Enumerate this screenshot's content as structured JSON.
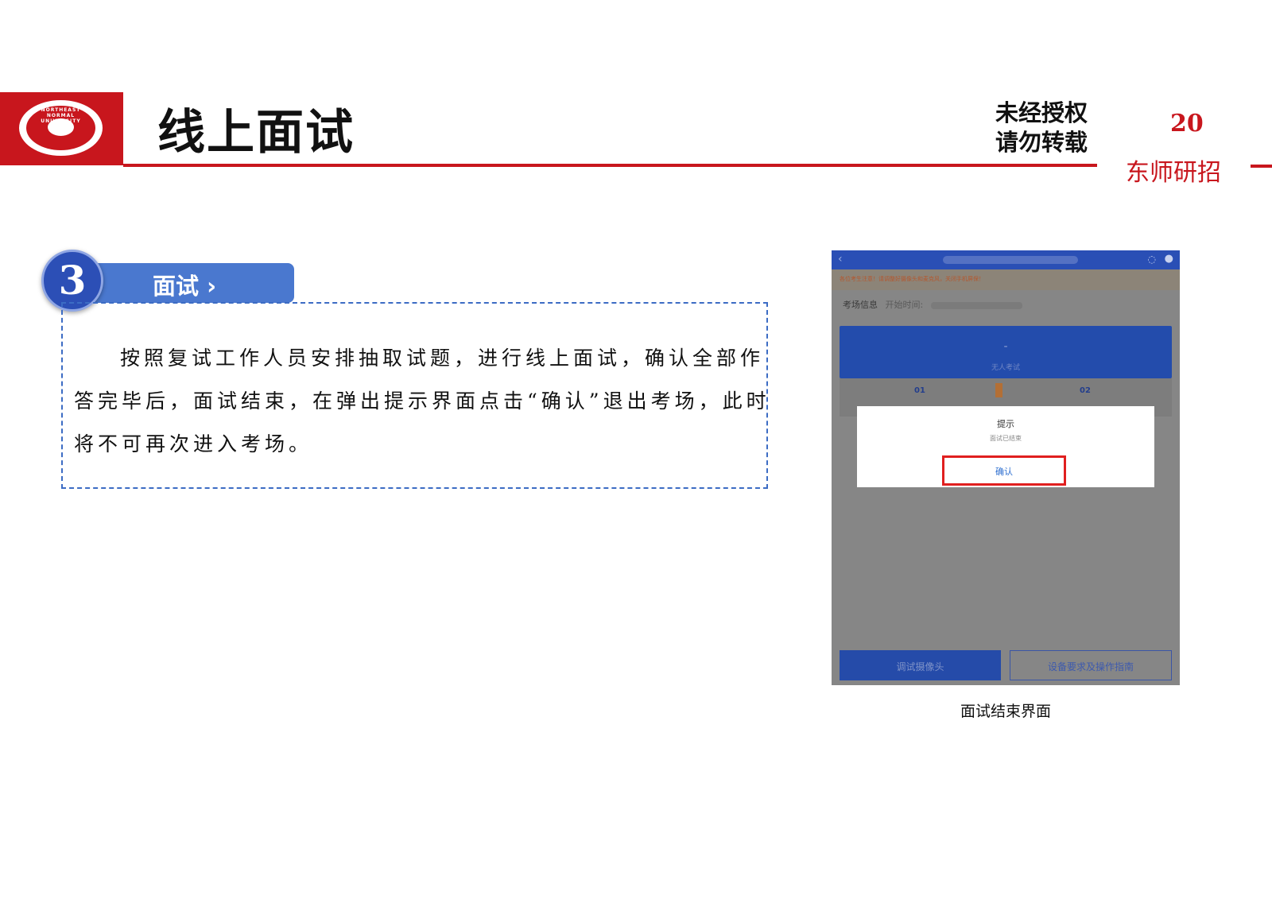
{
  "header": {
    "title": "线上面试",
    "watermark_line1": "未经授权",
    "watermark_line2": "请勿转载",
    "page_number": "20",
    "brand": "东师研招"
  },
  "step": {
    "number": "3",
    "label": "面试 ›"
  },
  "body": {
    "paragraph": "按照复试工作人员安排抽取试题，进行线上面试，确认全部作答完毕后，面试结束，在弹出提示界面点击“确认”退出考场，此时将不可再次进入考场。"
  },
  "screenshot": {
    "notice": "各位考生注意！请调整好摄像头和麦克风，关闭手机屏保！",
    "info_label": "考场信息",
    "info_time_label": "开始时间:",
    "card_dash": "-",
    "card_subtitle": "无人考试",
    "step_01": "01",
    "step_02": "02",
    "dialog": {
      "title": "提示",
      "message": "面试已结束",
      "confirm": "确认"
    },
    "btn_camera": "调试摄像头",
    "btn_guide": "设备要求及操作指南"
  },
  "caption": "面试结束界面",
  "colors": {
    "brand_red": "#c8161d",
    "step_blue": "#4a78cf",
    "highlight_red": "#e01f1f"
  }
}
